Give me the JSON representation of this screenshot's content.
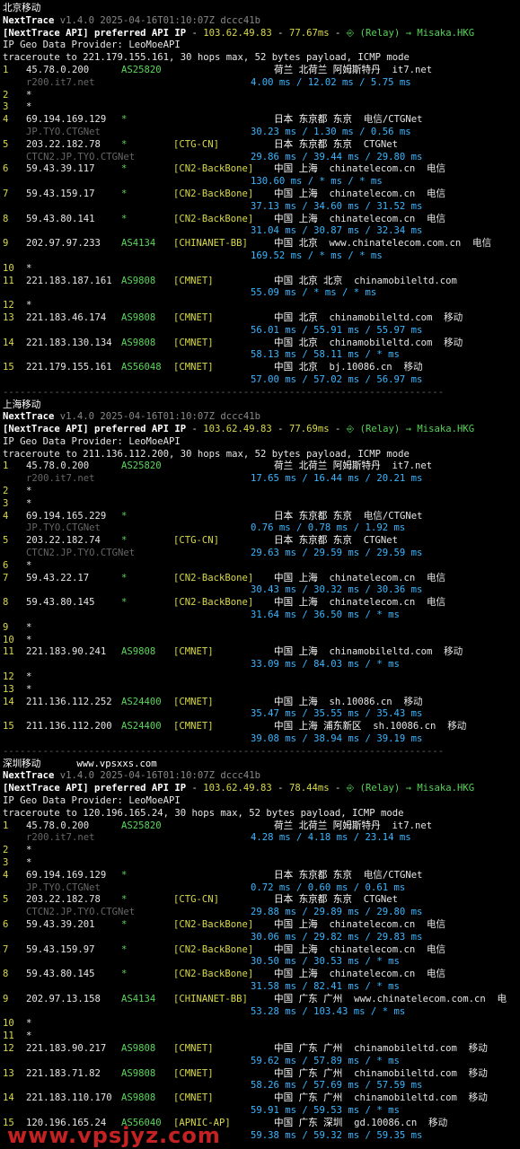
{
  "sections": [
    {
      "title": "北京移动",
      "site": "",
      "header": "NextTrace v1.4.0 2025-04-16T01:10:07Z dccc41b",
      "api_line": "[NextTrace API] preferred API IP - 103.62.49.83 - 77.67ms - ⎆ (Relay) → Misaka.HKG",
      "geo_provider": "IP Geo Data Provider: LeoMoeAPI",
      "trace_line": "traceroute to 221.179.155.161, 30 hops max, 52 bytes payload, ICMP mode",
      "hops": [
        {
          "n": "1",
          "ip": "45.78.0.200",
          "asn": "AS25820",
          "tag": "",
          "geo": "荷兰 北荷兰 阿姆斯特丹",
          "org": "it7.net",
          "host": "r200.it7.net",
          "rtt": "4.00 ms / 12.02 ms / 5.75 ms"
        },
        {
          "n": "2",
          "ip": "*",
          "asn": "",
          "tag": "",
          "geo": "",
          "org": "",
          "host": "",
          "rtt": ""
        },
        {
          "n": "3",
          "ip": "*",
          "asn": "",
          "tag": "",
          "geo": "",
          "org": "",
          "host": "",
          "rtt": ""
        },
        {
          "n": "4",
          "ip": "69.194.169.129",
          "asn": "*",
          "tag": "",
          "geo": "日本 东京都 东京",
          "org": "电信/CTGNet",
          "host": "JP.TYO.CTGNet",
          "rtt": "30.23 ms / 1.30 ms / 0.56 ms"
        },
        {
          "n": "5",
          "ip": "203.22.182.78",
          "asn": "*",
          "tag": "[CTG-CN]",
          "geo": "日本 东京都 东京",
          "org": "CTGNet",
          "host": "CTCN2.JP.TYO.CTGNet",
          "rtt": "29.86 ms / 39.44 ms / 29.80 ms"
        },
        {
          "n": "6",
          "ip": "59.43.39.117",
          "asn": "*",
          "tag": "[CN2-BackBone]",
          "geo": "中国 上海",
          "org": "chinatelecom.cn  电信",
          "host": "",
          "rtt": "130.60 ms / * ms / * ms"
        },
        {
          "n": "7",
          "ip": "59.43.159.17",
          "asn": "*",
          "tag": "[CN2-BackBone]",
          "geo": "中国 上海",
          "org": "chinatelecom.cn  电信",
          "host": "",
          "rtt": "37.13 ms / 34.60 ms / 31.52 ms"
        },
        {
          "n": "8",
          "ip": "59.43.80.141",
          "asn": "*",
          "tag": "[CN2-BackBone]",
          "geo": "中国 上海",
          "org": "chinatelecom.cn  电信",
          "host": "",
          "rtt": "31.04 ms / 30.87 ms / 32.34 ms"
        },
        {
          "n": "9",
          "ip": "202.97.97.233",
          "asn": "AS4134",
          "tag": "[CHINANET-BB]",
          "geo": "中国 北京",
          "org": "www.chinatelecom.com.cn  电信",
          "host": "",
          "rtt": "169.52 ms / * ms / * ms"
        },
        {
          "n": "10",
          "ip": "*",
          "asn": "",
          "tag": "",
          "geo": "",
          "org": "",
          "host": "",
          "rtt": ""
        },
        {
          "n": "11",
          "ip": "221.183.187.161",
          "asn": "AS9808",
          "tag": "[CMNET]",
          "geo": "中国 北京 北京",
          "org": "chinamobileltd.com",
          "host": "",
          "rtt": "55.09 ms / * ms / * ms"
        },
        {
          "n": "12",
          "ip": "*",
          "asn": "",
          "tag": "",
          "geo": "",
          "org": "",
          "host": "",
          "rtt": ""
        },
        {
          "n": "13",
          "ip": "221.183.46.174",
          "asn": "AS9808",
          "tag": "[CMNET]",
          "geo": "中国 北京",
          "org": "chinamobileltd.com  移动",
          "host": "",
          "rtt": "56.01 ms / 55.91 ms / 55.97 ms"
        },
        {
          "n": "14",
          "ip": "221.183.130.134",
          "asn": "AS9808",
          "tag": "[CMNET]",
          "geo": "中国 北京",
          "org": "chinamobileltd.com  移动",
          "host": "",
          "rtt": "58.13 ms / 58.11 ms / * ms"
        },
        {
          "n": "15",
          "ip": "221.179.155.161",
          "asn": "AS56048",
          "tag": "[CMNET]",
          "geo": "中国 北京",
          "org": "bj.10086.cn  移动",
          "host": "",
          "rtt": "57.00 ms / 57.02 ms / 56.97 ms"
        }
      ]
    },
    {
      "title": "上海移动",
      "site": "",
      "header": "NextTrace v1.4.0 2025-04-16T01:10:07Z dccc41b",
      "api_line": "[NextTrace API] preferred API IP - 103.62.49.83 - 77.69ms - ⎆ (Relay) → Misaka.HKG",
      "geo_provider": "IP Geo Data Provider: LeoMoeAPI",
      "trace_line": "traceroute to 211.136.112.200, 30 hops max, 52 bytes payload, ICMP mode",
      "hops": [
        {
          "n": "1",
          "ip": "45.78.0.200",
          "asn": "AS25820",
          "tag": "",
          "geo": "荷兰 北荷兰 阿姆斯特丹",
          "org": "it7.net",
          "host": "r200.it7.net",
          "rtt": "17.65 ms / 16.44 ms / 20.21 ms"
        },
        {
          "n": "2",
          "ip": "*",
          "asn": "",
          "tag": "",
          "geo": "",
          "org": "",
          "host": "",
          "rtt": ""
        },
        {
          "n": "3",
          "ip": "*",
          "asn": "",
          "tag": "",
          "geo": "",
          "org": "",
          "host": "",
          "rtt": ""
        },
        {
          "n": "4",
          "ip": "69.194.165.229",
          "asn": "*",
          "tag": "",
          "geo": "日本 东京都 东京",
          "org": "电信/CTGNet",
          "host": "JP.TYO.CTGNet",
          "rtt": "0.76 ms / 0.78 ms / 1.92 ms"
        },
        {
          "n": "5",
          "ip": "203.22.182.74",
          "asn": "*",
          "tag": "[CTG-CN]",
          "geo": "日本 东京都 东京",
          "org": "CTGNet",
          "host": "CTCN2.JP.TYO.CTGNet",
          "rtt": "29.63 ms / 29.59 ms / 29.59 ms"
        },
        {
          "n": "6",
          "ip": "*",
          "asn": "",
          "tag": "",
          "geo": "",
          "org": "",
          "host": "",
          "rtt": ""
        },
        {
          "n": "7",
          "ip": "59.43.22.17",
          "asn": "*",
          "tag": "[CN2-BackBone]",
          "geo": "中国 上海",
          "org": "chinatelecom.cn  电信",
          "host": "",
          "rtt": "30.43 ms / 30.32 ms / 30.36 ms"
        },
        {
          "n": "8",
          "ip": "59.43.80.145",
          "asn": "*",
          "tag": "[CN2-BackBone]",
          "geo": "中国 上海",
          "org": "chinatelecom.cn  电信",
          "host": "",
          "rtt": "31.64 ms / 36.50 ms / * ms"
        },
        {
          "n": "9",
          "ip": "*",
          "asn": "",
          "tag": "",
          "geo": "",
          "org": "",
          "host": "",
          "rtt": ""
        },
        {
          "n": "10",
          "ip": "*",
          "asn": "",
          "tag": "",
          "geo": "",
          "org": "",
          "host": "",
          "rtt": ""
        },
        {
          "n": "11",
          "ip": "221.183.90.241",
          "asn": "AS9808",
          "tag": "[CMNET]",
          "geo": "中国 上海",
          "org": "chinamobileltd.com  移动",
          "host": "",
          "rtt": "33.09 ms / 84.03 ms / * ms"
        },
        {
          "n": "12",
          "ip": "*",
          "asn": "",
          "tag": "",
          "geo": "",
          "org": "",
          "host": "",
          "rtt": ""
        },
        {
          "n": "13",
          "ip": "*",
          "asn": "",
          "tag": "",
          "geo": "",
          "org": "",
          "host": "",
          "rtt": ""
        },
        {
          "n": "14",
          "ip": "211.136.112.252",
          "asn": "AS24400",
          "tag": "[CMNET]",
          "geo": "中国 上海",
          "org": "sh.10086.cn  移动",
          "host": "",
          "rtt": "35.47 ms / 35.55 ms / 35.43 ms"
        },
        {
          "n": "15",
          "ip": "211.136.112.200",
          "asn": "AS24400",
          "tag": "[CMNET]",
          "geo": "中国 上海 浦东新区",
          "org": "sh.10086.cn  移动",
          "host": "",
          "rtt": "39.08 ms / 38.94 ms / 39.19 ms"
        }
      ]
    },
    {
      "title": "深圳移动",
      "site": "www.vpsxxs.com",
      "header": "NextTrace v1.4.0 2025-04-16T01:10:07Z dccc41b",
      "api_line": "[NextTrace API] preferred API IP - 103.62.49.83 - 78.44ms - ⎆ (Relay) → Misaka.HKG",
      "geo_provider": "IP Geo Data Provider: LeoMoeAPI",
      "trace_line": "traceroute to 120.196.165.24, 30 hops max, 52 bytes payload, ICMP mode",
      "hops": [
        {
          "n": "1",
          "ip": "45.78.0.200",
          "asn": "AS25820",
          "tag": "",
          "geo": "荷兰 北荷兰 阿姆斯特丹",
          "org": "it7.net",
          "host": "r200.it7.net",
          "rtt": "4.28 ms / 4.18 ms / 23.14 ms"
        },
        {
          "n": "2",
          "ip": "*",
          "asn": "",
          "tag": "",
          "geo": "",
          "org": "",
          "host": "",
          "rtt": ""
        },
        {
          "n": "3",
          "ip": "*",
          "asn": "",
          "tag": "",
          "geo": "",
          "org": "",
          "host": "",
          "rtt": ""
        },
        {
          "n": "4",
          "ip": "69.194.169.129",
          "asn": "*",
          "tag": "",
          "geo": "日本 东京都 东京",
          "org": "电信/CTGNet",
          "host": "JP.TYO.CTGNet",
          "rtt": "0.72 ms / 0.60 ms / 0.61 ms"
        },
        {
          "n": "5",
          "ip": "203.22.182.78",
          "asn": "*",
          "tag": "[CTG-CN]",
          "geo": "日本 东京都 东京",
          "org": "CTGNet",
          "host": "CTCN2.JP.TYO.CTGNet",
          "rtt": "29.88 ms / 29.89 ms / 29.80 ms"
        },
        {
          "n": "6",
          "ip": "59.43.39.201",
          "asn": "*",
          "tag": "[CN2-BackBone]",
          "geo": "中国 上海",
          "org": "chinatelecom.cn  电信",
          "host": "",
          "rtt": "30.06 ms / 29.82 ms / 29.83 ms"
        },
        {
          "n": "7",
          "ip": "59.43.159.97",
          "asn": "*",
          "tag": "[CN2-BackBone]",
          "geo": "中国 上海",
          "org": "chinatelecom.cn  电信",
          "host": "",
          "rtt": "30.50 ms / 30.53 ms / * ms"
        },
        {
          "n": "8",
          "ip": "59.43.80.145",
          "asn": "*",
          "tag": "[CN2-BackBone]",
          "geo": "中国 上海",
          "org": "chinatelecom.cn  电信",
          "host": "",
          "rtt": "31.58 ms / 82.41 ms / * ms"
        },
        {
          "n": "9",
          "ip": "202.97.13.158",
          "asn": "AS4134",
          "tag": "[CHINANET-BB]",
          "geo": "中国 广东 广州",
          "org": "www.chinatelecom.com.cn  电",
          "host": "",
          "rtt": "53.28 ms / 103.43 ms / * ms"
        },
        {
          "n": "10",
          "ip": "*",
          "asn": "",
          "tag": "",
          "geo": "",
          "org": "",
          "host": "",
          "rtt": ""
        },
        {
          "n": "11",
          "ip": "*",
          "asn": "",
          "tag": "",
          "geo": "",
          "org": "",
          "host": "",
          "rtt": ""
        },
        {
          "n": "12",
          "ip": "221.183.90.217",
          "asn": "AS9808",
          "tag": "[CMNET]",
          "geo": "中国 广东 广州",
          "org": "chinamobileltd.com  移动",
          "host": "",
          "rtt": "59.62 ms / 57.89 ms / * ms"
        },
        {
          "n": "13",
          "ip": "221.183.71.82",
          "asn": "AS9808",
          "tag": "[CMNET]",
          "geo": "中国 广东 广州",
          "org": "chinamobileltd.com  移动",
          "host": "",
          "rtt": "58.26 ms / 57.69 ms / 57.59 ms"
        },
        {
          "n": "14",
          "ip": "221.183.110.170",
          "asn": "AS9808",
          "tag": "[CMNET]",
          "geo": "中国 广东 广州",
          "org": "chinamobileltd.com  移动",
          "host": "",
          "rtt": "59.91 ms / 59.53 ms / * ms"
        },
        {
          "n": "15",
          "ip": "120.196.165.24",
          "asn": "AS56040",
          "tag": "[APNIC-AP]",
          "geo": "中国 广东 深圳",
          "org": "gd.10086.cn  移动",
          "host": "",
          "rtt": "59.38 ms / 59.32 ms / 59.35 ms"
        }
      ]
    }
  ],
  "separator": "-----------------------------------------------------------------------------",
  "watermark": "www.vpsjyz.com"
}
